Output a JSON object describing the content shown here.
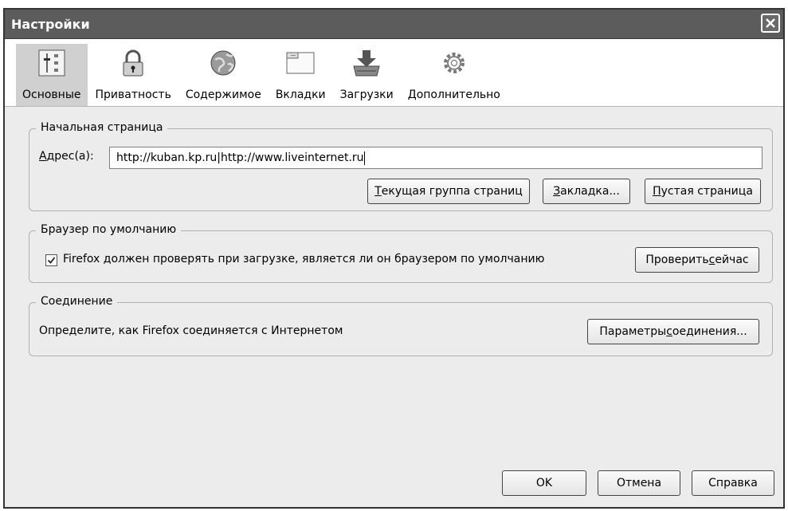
{
  "window": {
    "title": "Настройки"
  },
  "tabs": [
    {
      "label": "Основные",
      "icon": "general-sliders-icon",
      "active": true
    },
    {
      "label": "Приватность",
      "icon": "padlock-icon",
      "active": false
    },
    {
      "label": "Содержимое",
      "icon": "globe-icon",
      "active": false
    },
    {
      "label": "Вкладки",
      "icon": "window-tabs-icon",
      "active": false
    },
    {
      "label": "Загрузки",
      "icon": "download-tray-icon",
      "active": false
    },
    {
      "label": "Дополнительно",
      "icon": "gear-icon",
      "active": false
    }
  ],
  "homepage": {
    "legend": "Начальная страница",
    "address_label_accel": "А",
    "address_label_rest": "дрес(а):",
    "address_value": "http://kuban.kp.ru|http://www.liveinternet.ru",
    "btn_current_accel": "Т",
    "btn_current_rest": "екущая группа страниц",
    "btn_bookmark_accel": "З",
    "btn_bookmark_rest": "акладка...",
    "btn_blank_accel": "П",
    "btn_blank_rest": "устая страница"
  },
  "default_browser": {
    "legend": "Браузер по умолчанию",
    "checkbox_pre": "Firefox ",
    "checkbox_accel": "д",
    "checkbox_rest": "олжен проверять при загрузке, является ли он браузером по умолчанию",
    "checked": true,
    "btn_check_pre": "Проверить ",
    "btn_check_accel": "с",
    "btn_check_rest": "ейчас"
  },
  "connection": {
    "legend": "Соединение",
    "description": "Определите, как Firefox соединяется с Интернетом",
    "btn_settings_pre": "Параметры ",
    "btn_settings_accel": "с",
    "btn_settings_rest": "оединения..."
  },
  "footer": {
    "ok": "OK",
    "cancel": "Отмена",
    "help": "Справка"
  },
  "colors": {
    "titlebar": "#5c5c5c",
    "dialog_bg": "#ececec",
    "active_tab": "#d0d0d0"
  }
}
